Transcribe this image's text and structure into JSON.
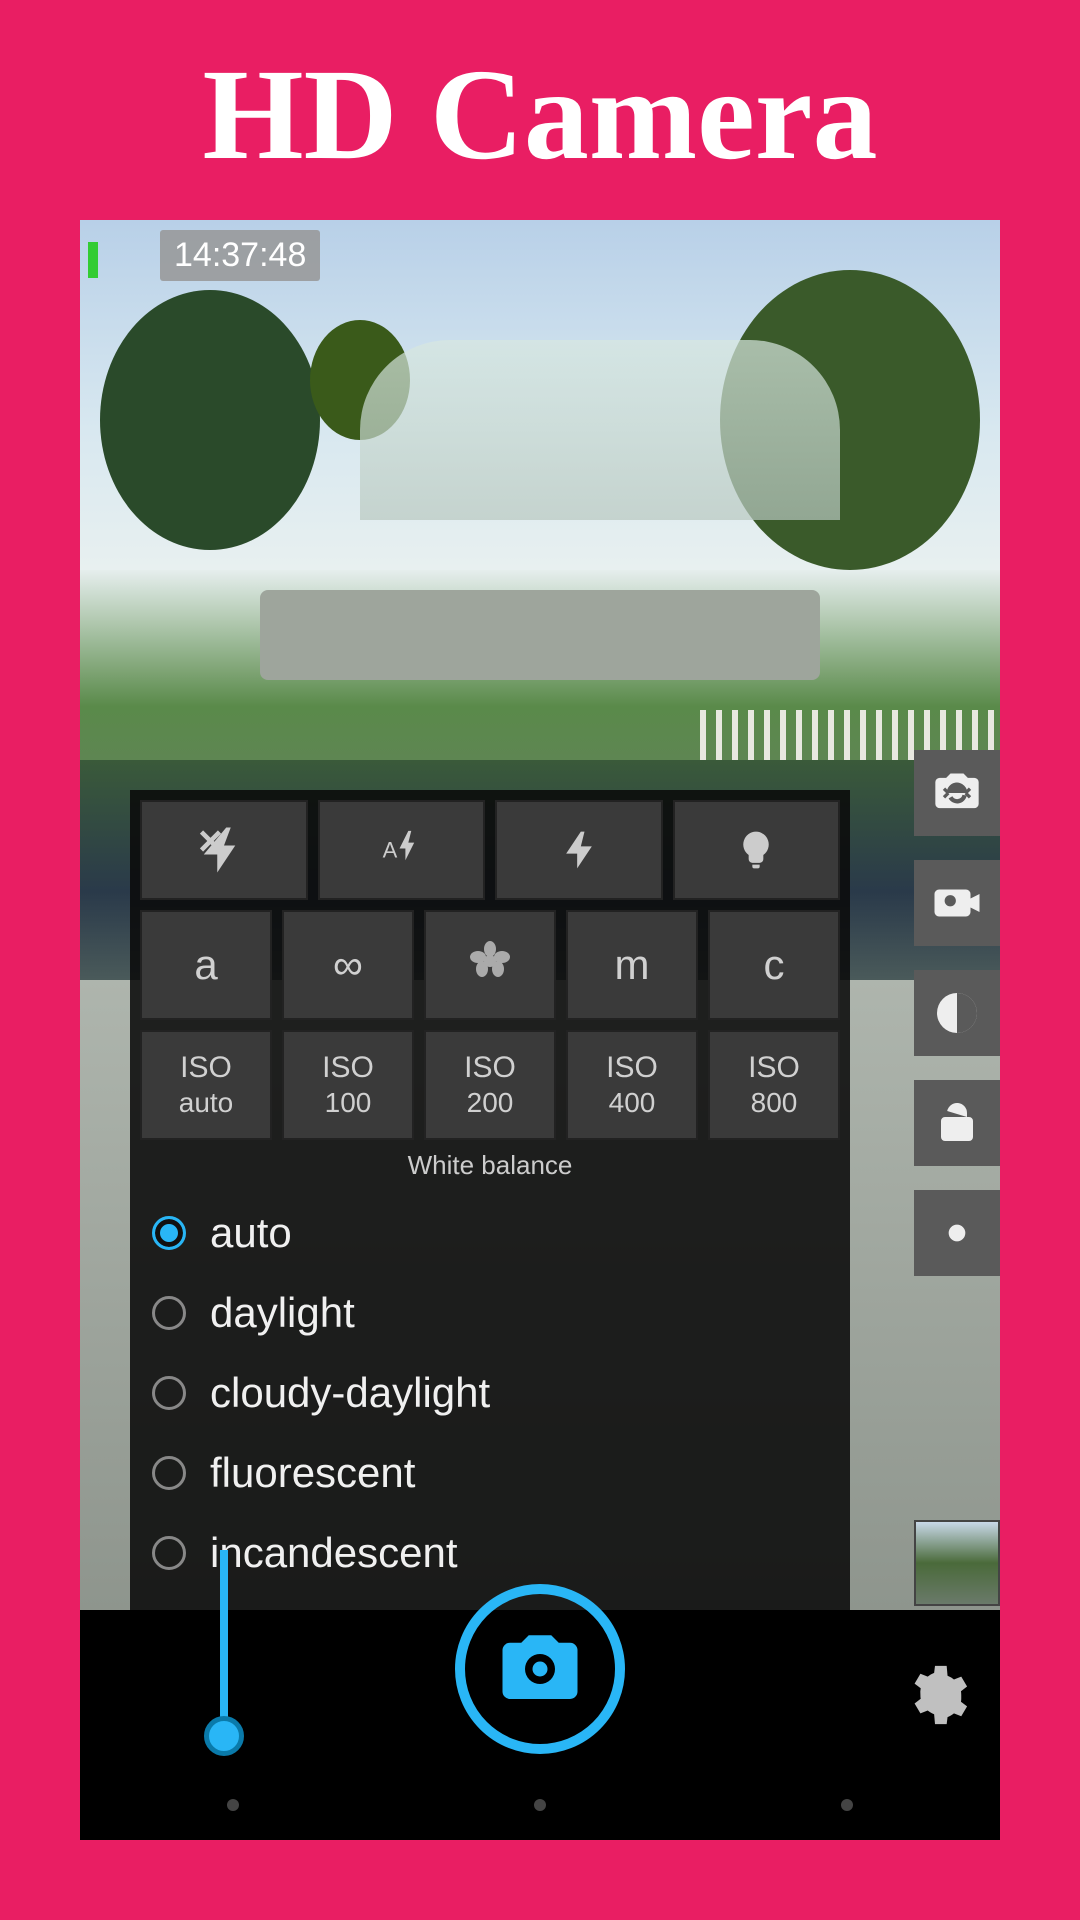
{
  "page_title": "HD Camera",
  "timer": "14:37:48",
  "flash_modes": [
    "flash-off",
    "flash-auto",
    "flash-on",
    "torch"
  ],
  "focus_modes": [
    {
      "label": "a",
      "name": "focus-auto"
    },
    {
      "label": "∞",
      "name": "focus-infinity"
    },
    {
      "label": "🌷",
      "name": "focus-macro",
      "icon": "flower"
    },
    {
      "label": "m",
      "name": "focus-manual"
    },
    {
      "label": "c",
      "name": "focus-continuous"
    }
  ],
  "iso_modes": [
    {
      "top": "ISO",
      "bottom": "auto"
    },
    {
      "top": "ISO",
      "bottom": "100"
    },
    {
      "top": "ISO",
      "bottom": "200"
    },
    {
      "top": "ISO",
      "bottom": "400"
    },
    {
      "top": "ISO",
      "bottom": "800"
    }
  ],
  "wb_title": "White balance",
  "white_balance": [
    {
      "label": "auto",
      "selected": true
    },
    {
      "label": "daylight",
      "selected": false
    },
    {
      "label": "cloudy-daylight",
      "selected": false
    },
    {
      "label": "fluorescent",
      "selected": false
    },
    {
      "label": "incandescent",
      "selected": false
    }
  ],
  "side_buttons": [
    "switch-camera",
    "photo-video-mode",
    "exposure",
    "lock",
    "color"
  ]
}
